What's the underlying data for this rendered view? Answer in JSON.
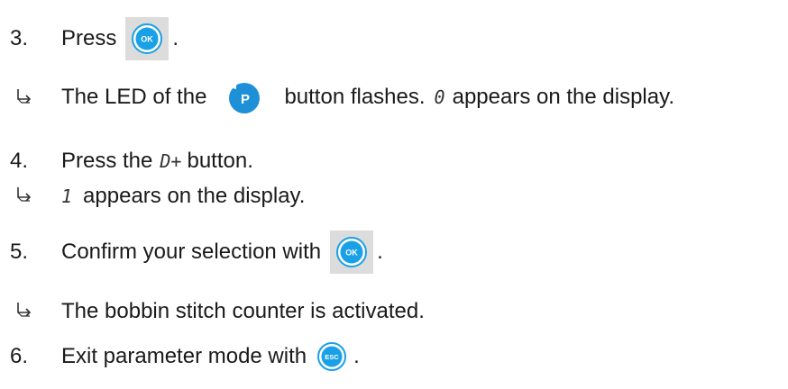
{
  "steps": [
    {
      "number": "3.",
      "before": "Press",
      "after": ".",
      "key": {
        "name": "ok-key",
        "label": "OK"
      }
    },
    {
      "number": "4.",
      "before": "Press the",
      "code": "D+",
      "after": "button."
    },
    {
      "number": "5.",
      "before": "Confirm your selection with",
      "after": ".",
      "key": {
        "name": "ok-key",
        "label": "OK"
      }
    },
    {
      "number": "6.",
      "before": "Exit parameter mode with",
      "after": ".",
      "key": {
        "name": "esc-key",
        "label": "ESC"
      }
    }
  ],
  "results": [
    {
      "before": "The LED of the",
      "button_label": "P",
      "after": "button flashes.",
      "code": "0",
      "tail": "appears on the display."
    },
    {
      "code": "1",
      "tail": "appears on the display."
    },
    {
      "text": "The bobbin stitch counter is activated."
    }
  ],
  "colors": {
    "key_blue": "#1aa0e6",
    "key_bg": "#dcdcdc",
    "p_blue": "#1e90d8"
  },
  "icons": {
    "result": "result-arrow-icon",
    "ok": "ok-key-icon",
    "esc": "esc-key-icon",
    "p": "p-button-icon"
  }
}
